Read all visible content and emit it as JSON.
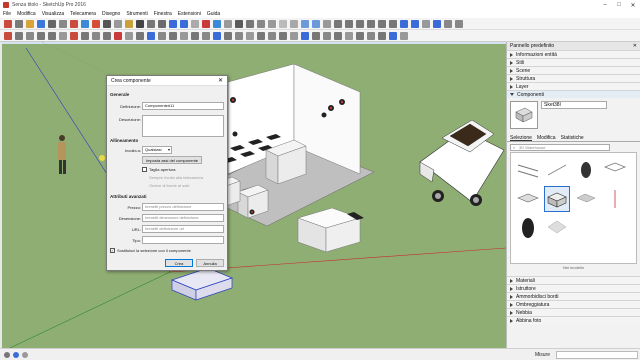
{
  "window": {
    "title": "Senza titolo - SketchUp Pro 2016"
  },
  "menu": [
    "File",
    "Modifica",
    "Visualizza",
    "Telecamera",
    "Disegno",
    "Strumenti",
    "Finestra",
    "Estensioni",
    "Guida"
  ],
  "tray": {
    "title": "Pannello predefinito",
    "sections_top": [
      "Informazioni entità",
      "Stili",
      "Scene",
      "Struttura",
      "Layer"
    ],
    "components": {
      "header": "Componenti",
      "name_value": "Sket38l",
      "tabs": [
        "Selezione",
        "Modifica",
        "Statistiche"
      ],
      "search_placeholder": "3D Warehouse",
      "footer_text": "Nel modello"
    },
    "sections_bottom": [
      "Materiali",
      "Istruttore",
      "Ammorbidisci bordi",
      "Ombreggiatura",
      "Nebbia",
      "Abbina foto"
    ]
  },
  "status": {
    "measure_label": "Misure"
  },
  "dialog": {
    "title": "Crea componente",
    "general_header": "Generale",
    "definition_label": "Definizione:",
    "definition_value": "Componente#11",
    "description_label": "Descrizione:",
    "alignment_header": "Allineamento",
    "glue_label": "Incolla a:",
    "glue_value": "Qualsiasi",
    "set_axes_button": "Imposta assi del componente",
    "cut_opening_label": "Taglia apertura",
    "always_face_label": "Sempre rivolto alla telecamera",
    "shadows_label": "Ombre di fronte al sole",
    "advanced_header": "Attributi avanzati",
    "price_label": "Prezzo:",
    "price_placeholder": "Immetti prezzo definizione",
    "size_label": "Dimensione:",
    "size_placeholder": "Immetti dimensioni definizione",
    "url_label": "URL:",
    "url_placeholder": "Immetti definizione url",
    "type_label": "Tipo:",
    "replace_label": "Sostituisci la selezione con il componente",
    "create_button": "Crea",
    "cancel_button": "Annulla"
  }
}
